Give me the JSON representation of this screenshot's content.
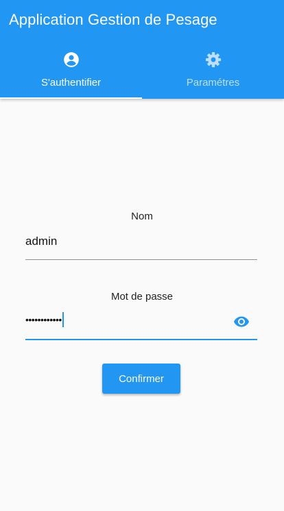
{
  "app_bar": {
    "title": "Application Gestion de Pesage"
  },
  "tabs": [
    {
      "label": "S'authentifier",
      "icon": "account-circle-icon",
      "active": true
    },
    {
      "label": "Paramétres",
      "icon": "gear-icon",
      "active": false
    }
  ],
  "login_form": {
    "name_field": {
      "label": "Nom",
      "value": "admin"
    },
    "password_field": {
      "label": "Mot de passe",
      "masked_value": "••••••••••••",
      "visibility_icon": "eye-icon"
    },
    "confirm_label": "Confirmer"
  },
  "colors": {
    "primary": "#2196f3",
    "background": "#fafafa",
    "on_primary": "#ffffff",
    "text": "#222222",
    "underline": "#8e8e8e"
  }
}
